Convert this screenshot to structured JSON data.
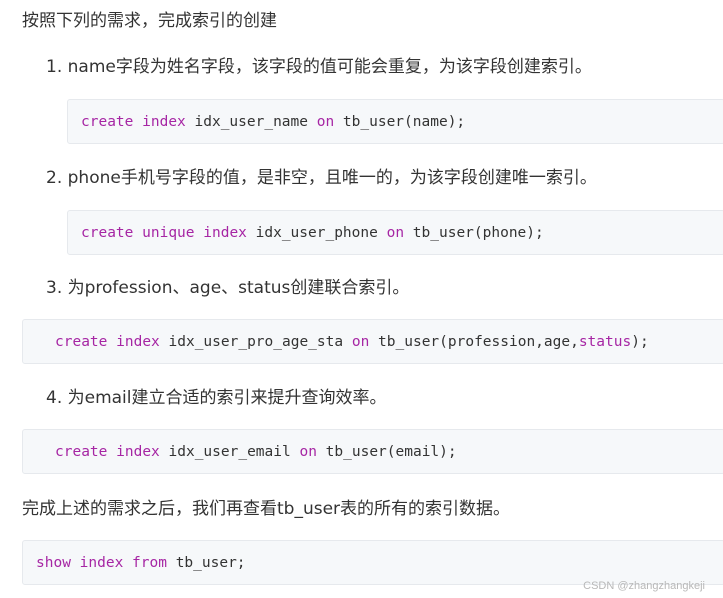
{
  "intro": "按照下列的需求，完成索引的创建",
  "items": [
    {
      "text": "1. name字段为姓名字段，该字段的值可能会重复，为该字段创建索引。",
      "code": {
        "k1": "create",
        "k2": "index",
        "t1": " idx_user_name ",
        "k3": "on",
        "t2": " tb_user(name);"
      }
    },
    {
      "text": "2. phone手机号字段的值，是非空，且唯一的，为该字段创建唯一索引。",
      "code": {
        "k1": "create",
        "k2": "unique",
        "k3": "index",
        "t1": " idx_user_phone ",
        "k4": "on",
        "t2": " tb_user(phone);"
      }
    },
    {
      "text": "3. 为profession、age、status创建联合索引。",
      "code": {
        "k1": "create",
        "k2": "index",
        "t1": " idx_user_pro_age_sta ",
        "k3": "on",
        "t2": " tb_user(profession,age,",
        "k4": "status",
        "t3": ");"
      }
    },
    {
      "text": "4. 为email建立合适的索引来提升查询效率。",
      "code": {
        "k1": "create",
        "k2": "index",
        "t1": " idx_user_email ",
        "k3": "on",
        "t2": " tb_user(email);"
      }
    }
  ],
  "outro": "完成上述的需求之后，我们再查看tb_user表的所有的索引数据。",
  "final_code": {
    "k1": "show",
    "k2": "index",
    "k3": "from",
    "t1": " tb_user;"
  },
  "watermark": "CSDN @zhangzhangkeji"
}
